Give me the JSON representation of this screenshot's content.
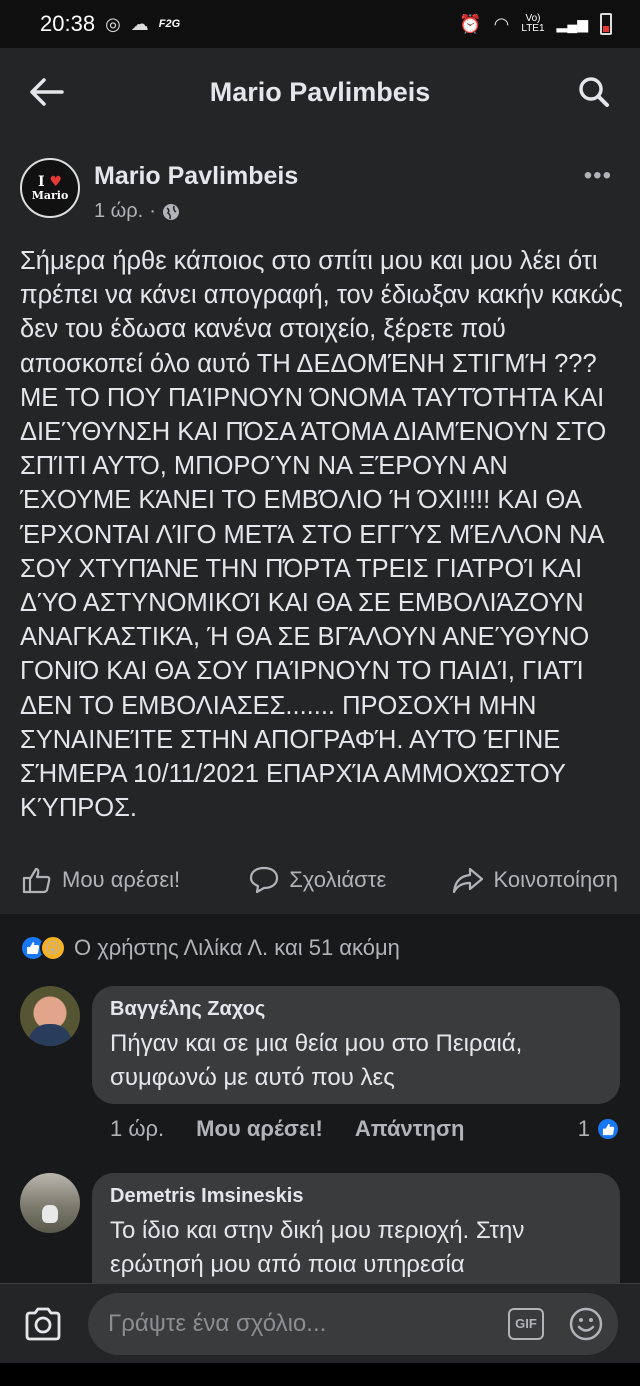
{
  "status_bar": {
    "time": "20:38",
    "network": "F2G",
    "signal_label": "Vo)\nLTE1"
  },
  "header": {
    "title": "Mario Pavlimbeis"
  },
  "post": {
    "author": "Mario Pavlimbeis",
    "time": "1 ώρ.",
    "avatar_text": "I ♥ Mario",
    "body": "Σήμερα ήρθε κάποιος στο σπίτι μου και μου λέει ότι πρέπει να κάνει απογραφή, τον έδιωξαν κακήν κακώς δεν του έδωσα κανένα στοιχείο, ξέρετε πού αποσκοπεί όλο αυτό ΤΗ ΔΕΔΟΜΈΝΗ ΣΤΙΓΜΉ ??? ΜΕ ΤΟ ΠΟΥ ΠΑΊΡΝΟΥΝ ΌΝΟΜΑ ΤΑΥΤΌΤΗΤΑ ΚΑΙ ΔΙΕΎΘΥΝΣΗ ΚΑΙ ΠΌΣΑ ΆΤΟΜΑ ΔΙΑΜΈΝΟΥΝ ΣΤΟ ΣΠΊΤΙ ΑΥΤΌ, ΜΠΟΡΟΎΝ ΝΑ ΞΈΡΟΥΝ ΑΝ ΈΧΟΥΜΕ ΚΆΝΕΙ ΤΟ ΕΜΒΌΛΙΟ Ή ΌΧΙ!!!! ΚΑΙ ΘΑ ΈΡΧΟΝΤΑΙ ΛΊΓΟ ΜΕΤΆ ΣΤΟ ΕΓΓΎΣ ΜΈΛΛΟΝ ΝΑ ΣΟΥ ΧΤΥΠΆΝΕ ΤΗΝ ΠΌΡΤΑ ΤΡΕΙΣ ΓΙΑΤΡΟΊ ΚΑΙ ΔΎΟ ΑΣΤΥΝΟΜΙΚΟΊ ΚΑΙ ΘΑ ΣΕ ΕΜΒΟΛΙΆΖΟΥΝ ΑΝΑΓΚΑΣΤΙΚΆ, Ή ΘΑ ΣΕ ΒΓΆΛΟΥΝ ΑΝΕΎΘΥΝΟ ΓΟΝΙΌ ΚΑΙ ΘΑ ΣΟΥ ΠΑΊΡΝΟΥΝ ΤΟ ΠΑΙΔΊ, ΓΙΑΤΊ ΔΕΝ ΤΟ ΕΜΒΟΛΙΑΣΕΣ....... ΠΡΟΣΟΧΉ ΜΗΝ ΣΥΝΑΙΝΕΊΤΕ ΣΤΗΝ ΑΠΟΓΡΑΦΉ. ΑΥΤΌ ΈΓΙΝΕ ΣΉΜΕΡΑ 10/11/2021 ΕΠΑΡΧΊΑ ΑΜΜΟΧΏΣΤΟΥ ΚΎΠΡΟΣ."
  },
  "actions": {
    "like": "Μου αρέσει!",
    "comment": "Σχολιάστε",
    "share": "Κοινοποίηση"
  },
  "reactions": {
    "summary": "Ο χρήστης Λιλίκα Λ. και 51 ακόμη"
  },
  "comments": [
    {
      "name": "Βαγγέλης Ζαχος",
      "text": "Πήγαν και σε μια θεία μου στο Πειραιά, συμφωνώ με αυτό που λες",
      "time": "1 ώρ.",
      "like_label": "Μου αρέσει!",
      "reply_label": "Απάντηση",
      "like_count": "1"
    },
    {
      "name": "Demetris Imsineskis",
      "text": "Το ίδιο και στην δική μου περιοχή. Στην ερώτησή μου από ποια υπηρεσία"
    }
  ],
  "composer": {
    "placeholder": "Γράψτε ένα σχόλιο...",
    "gif_label": "GIF"
  },
  "colors": {
    "background": "#18191a",
    "surface": "#242526",
    "bubble": "#3a3b3c",
    "like_blue": "#1877f2"
  }
}
